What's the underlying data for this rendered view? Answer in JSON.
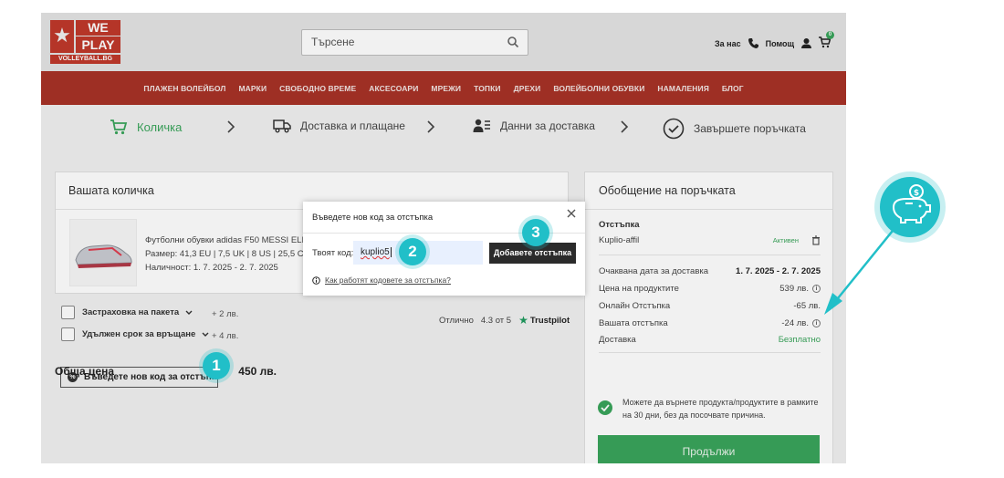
{
  "header": {
    "logo": {
      "line1": "WE",
      "line2": "PLAY",
      "line3": "VOLLEYBALL.BG"
    },
    "search_placeholder": "Търсене",
    "links": {
      "about": "За нас",
      "help": "Помощ"
    },
    "cart_count": "0"
  },
  "nav": {
    "items": [
      "ПЛАЖЕН ВОЛЕЙБОЛ",
      "МАРКИ",
      "СВОБОДНО ВРЕМЕ",
      "АКСЕСОАРИ",
      "МРЕЖИ",
      "ТОПКИ",
      "ДРЕХИ",
      "ВОЛЕЙБОЛНИ ОБУВКИ",
      "НАМАЛЕНИЯ",
      "БЛОГ"
    ]
  },
  "steps": {
    "cart": "Количка",
    "delivery_payment": "Доставка и плащане",
    "delivery_data": "Данни за доставка",
    "finish": "Завършете поръчката"
  },
  "cart": {
    "title": "Вашата количка",
    "product": {
      "name": "Футболни обувки adidas F50 MESSI ELITE F",
      "size": "Размер: 41,3 EU | 7,5 UK | 8 US | 25,5 CM",
      "availability": "Наличност:  1. 7. 2025 - 2. 7. 2025"
    },
    "options": [
      {
        "label": "Застраховка на пакета",
        "price": "+ 2 лв."
      },
      {
        "label": "Удължен срок за връщане",
        "price": "+ 4 лв."
      }
    ],
    "trust": {
      "rating_label": "Отлично",
      "rating": "4.3 от 5",
      "brand": "Trustpilot"
    },
    "discount_button": "Въведете нов код за отстъпка"
  },
  "summary": {
    "title": "Обобщение на поръчката",
    "discount_heading": "Отстъпка",
    "discount_code": "Kuplio-affil",
    "discount_status": "Активен",
    "rows": [
      {
        "label": "Очаквана дата за доставка",
        "value": "1. 7. 2025 - 2. 7. 2025"
      },
      {
        "label": "Цена на продуктите",
        "value": "539 лв."
      },
      {
        "label": "Онлайн Отстъпка",
        "value": "-65 лв."
      },
      {
        "label": "Вашата отстъпка",
        "value": "-24 лв."
      },
      {
        "label": "Доставка",
        "value": "Безплатно"
      }
    ],
    "total_label": "Обща цена",
    "total_value": "450 лв.",
    "return_text": "Можете да върнете продукта/продуктите в рамките на 30 дни, без да посочвате причина.",
    "continue_button": "Продължи"
  },
  "modal": {
    "title": "Въведете нов код за отстъпка",
    "code_label": "Твоят код:",
    "code_value": "kuplio5",
    "apply_button": "Добавете отстъпка",
    "help_link": "Как работят кодовете за отстъпка?"
  },
  "callouts": [
    "1",
    "2",
    "3"
  ],
  "colors": {
    "brand_red": "#a83227",
    "accent_green": "#3aa55b",
    "callout_teal": "#21bfc8"
  }
}
